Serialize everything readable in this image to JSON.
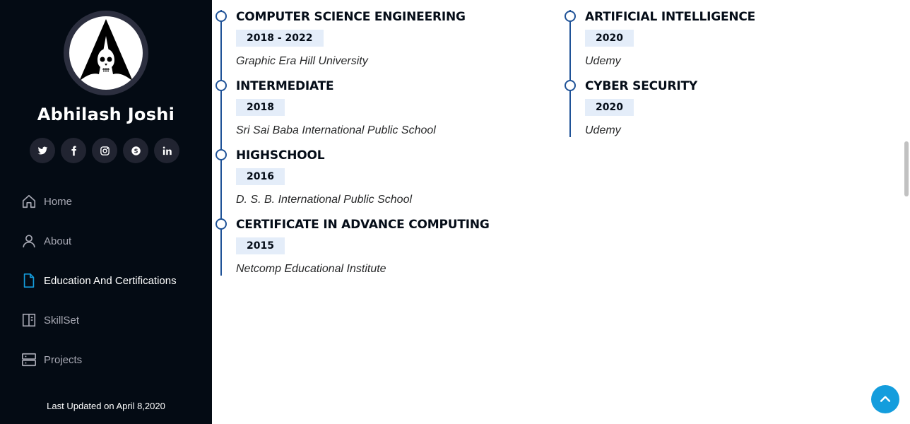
{
  "profile": {
    "name": "Abhilash Joshi"
  },
  "social": [
    {
      "name": "twitter-icon"
    },
    {
      "name": "facebook-icon"
    },
    {
      "name": "instagram-icon"
    },
    {
      "name": "skype-icon"
    },
    {
      "name": "linkedin-icon"
    }
  ],
  "nav": [
    {
      "label": "Home",
      "icon": "home-icon"
    },
    {
      "label": "About",
      "icon": "user-icon"
    },
    {
      "label": "Education And Certifications",
      "icon": "file-icon",
      "active": true
    },
    {
      "label": "SkillSet",
      "icon": "book-icon"
    },
    {
      "label": "Projects",
      "icon": "server-icon"
    }
  ],
  "footer": {
    "note": "Last Updated on April 8,2020"
  },
  "education": [
    {
      "title": "COMPUTER SCIENCE ENGINEERING",
      "year": "2018 - 2022",
      "org": "Graphic Era Hill University"
    },
    {
      "title": "INTERMEDIATE",
      "year": "2018",
      "org": "Sri Sai Baba International Public School"
    },
    {
      "title": "HIGHSCHOOL",
      "year": "2016",
      "org": "D. S. B. International Public School"
    },
    {
      "title": "CERTIFICATE IN ADVANCE COMPUTING",
      "year": "2015",
      "org": "Netcomp Educational Institute"
    }
  ],
  "certifications": [
    {
      "title": "ARTIFICIAL INTELLIGENCE",
      "year": "2020",
      "org": "Udemy"
    },
    {
      "title": "CYBER SECURITY",
      "year": "2020",
      "org": "Udemy"
    }
  ],
  "colors": {
    "sidebar_bg": "#040b14",
    "accent": "#149ddd",
    "timeline": "#1f5297",
    "year_badge_bg": "#e4edf9"
  }
}
